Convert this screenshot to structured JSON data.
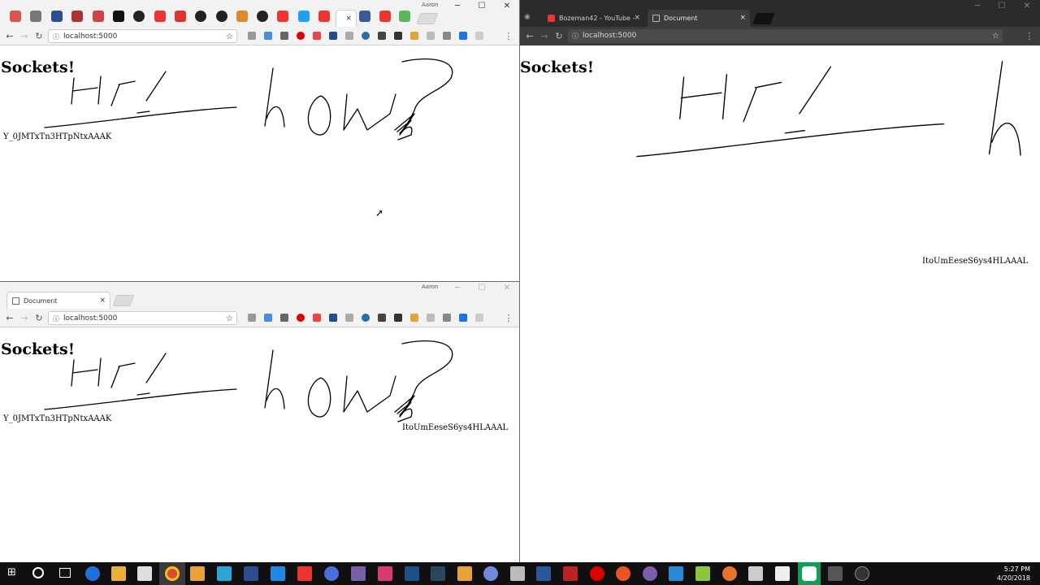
{
  "windows": {
    "top_left": {
      "address": "localhost:5000",
      "user_name": "Aaron",
      "tab_close": "×",
      "heading": "Sockets!",
      "socket_ids": [
        "Y_0JMTxTn3HTpNtxAAAK"
      ]
    },
    "bottom_left": {
      "tab_title": "Document",
      "address": "localhost:5000",
      "user_name": "Aaron",
      "heading": "Sockets!",
      "socket_ids": [
        "Y_0JMTxTn3HTpNtxAAAK",
        "ItoUmEeseS6ys4HLAAAL"
      ]
    },
    "right": {
      "tab1_title": "Bozeman42 - YouTube -",
      "tab2_title": "Document",
      "address": "localhost:5000",
      "heading": "Sockets!",
      "socket_ids": [
        "ItoUmEeseS6ys4HLAAAL"
      ]
    }
  },
  "window_controls": {
    "minimize": "─",
    "maximize": "☐",
    "close": "✕"
  },
  "nav": {
    "back": "←",
    "forward": "→",
    "reload": "↻",
    "info": "ⓘ",
    "star": "☆",
    "menu": "⋮"
  },
  "taskbar": {
    "time": "5:27 PM",
    "date": "4/20/2018"
  },
  "colors": {
    "light_chrome": "#f2f2f2",
    "dark_chrome": "#2b2b2b",
    "taskbar": "#101010",
    "ink": "#000000"
  }
}
